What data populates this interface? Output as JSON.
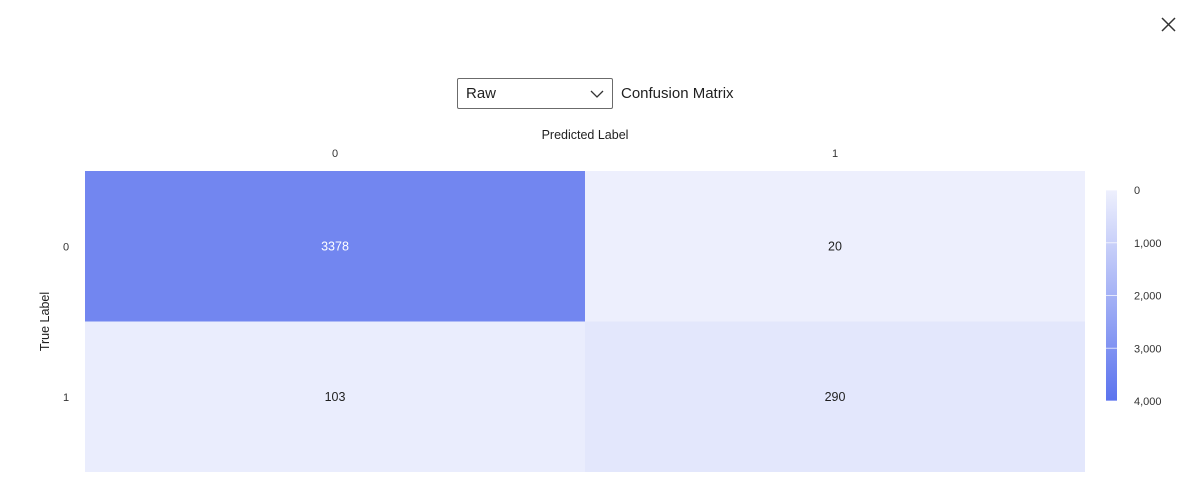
{
  "header": {
    "select_value": "Raw",
    "title": "Confusion Matrix"
  },
  "icons": {
    "close": "close-icon",
    "chevron": "chevron-down-icon"
  },
  "chart_data": {
    "type": "heatmap",
    "title": "Confusion Matrix",
    "xlabel": "Predicted Label",
    "ylabel": "True Label",
    "x_categories": [
      "0",
      "1"
    ],
    "y_categories": [
      "0",
      "1"
    ],
    "values": [
      [
        3378,
        20
      ],
      [
        103,
        290
      ]
    ],
    "colorscale": {
      "min": 0,
      "max": 4000,
      "low_color": "#eef0fd",
      "high_color": "#5b73ee",
      "ticks": [
        0,
        1000,
        2000,
        3000,
        4000
      ],
      "tick_labels": [
        "0",
        "1,000",
        "2,000",
        "3,000",
        "4,000"
      ]
    },
    "text_color_light": "#ffffff",
    "text_color_dark": "#1f1f1f"
  }
}
